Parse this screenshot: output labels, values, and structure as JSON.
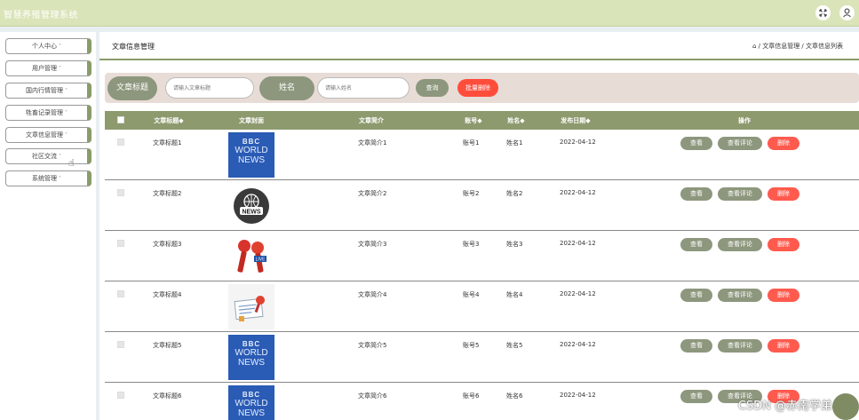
{
  "app": {
    "title": "智慧养殖管理系统"
  },
  "header": {
    "fullscreen_icon": "expand-icon",
    "user_icon": "user-icon"
  },
  "sidebar": {
    "items": [
      {
        "label": "个人中心"
      },
      {
        "label": "用户管理"
      },
      {
        "label": "国内行情管理"
      },
      {
        "label": "牲畜记录管理"
      },
      {
        "label": "文章信息管理"
      },
      {
        "label": "社区交流"
      },
      {
        "label": "系统管理"
      }
    ]
  },
  "breadcrumb": {
    "title": "文章信息管理",
    "path": "⌂ / 文章信息管理 / 文章信息列表"
  },
  "search": {
    "title_label": "文章标题",
    "title_placeholder": "请输入文章标题",
    "name_label": "姓名",
    "name_placeholder": "请输入姓名",
    "query_button": "查询",
    "batch_delete_button": "批量删除"
  },
  "table": {
    "headers": [
      "文章标题◆",
      "文章封面",
      "文章简介",
      "账号◆",
      "姓名◆",
      "发布日期◆",
      "操作"
    ],
    "actions": {
      "view": "查看",
      "view_comments": "查看评论",
      "delete": "删除"
    },
    "rows": [
      {
        "title": "文章标题1",
        "cover": "bbc",
        "intro": "文章简介1",
        "account": "账号1",
        "name": "姓名1",
        "date": "2022-04-12"
      },
      {
        "title": "文章标题2",
        "cover": "news-globe",
        "intro": "文章简介2",
        "account": "账号2",
        "name": "姓名2",
        "date": "2022-04-12"
      },
      {
        "title": "文章标题3",
        "cover": "microphones",
        "intro": "文章简介3",
        "account": "账号3",
        "name": "姓名3",
        "date": "2022-04-12"
      },
      {
        "title": "文章标题4",
        "cover": "newspaper",
        "intro": "文章简介4",
        "account": "账号4",
        "name": "姓名4",
        "date": "2022-04-12"
      },
      {
        "title": "文章标题5",
        "cover": "bbc",
        "intro": "文章简介5",
        "account": "账号5",
        "name": "姓名5",
        "date": "2022-04-12"
      },
      {
        "title": "文章标题6",
        "cover": "bbc",
        "intro": "文章简介6",
        "account": "账号6",
        "name": "姓名6",
        "date": "2022-04-12"
      }
    ]
  },
  "bbc_cover": {
    "line1": "BBC",
    "line2": "WORLD",
    "line3": "NEWS"
  },
  "news_badge": "NEWS",
  "live_badge": "LIVE",
  "watermark": "CSDN @赤南学弟",
  "colors": {
    "accent": "#8d9a6e",
    "danger": "#ff5a4e",
    "topbar": "#d9e4b8"
  }
}
